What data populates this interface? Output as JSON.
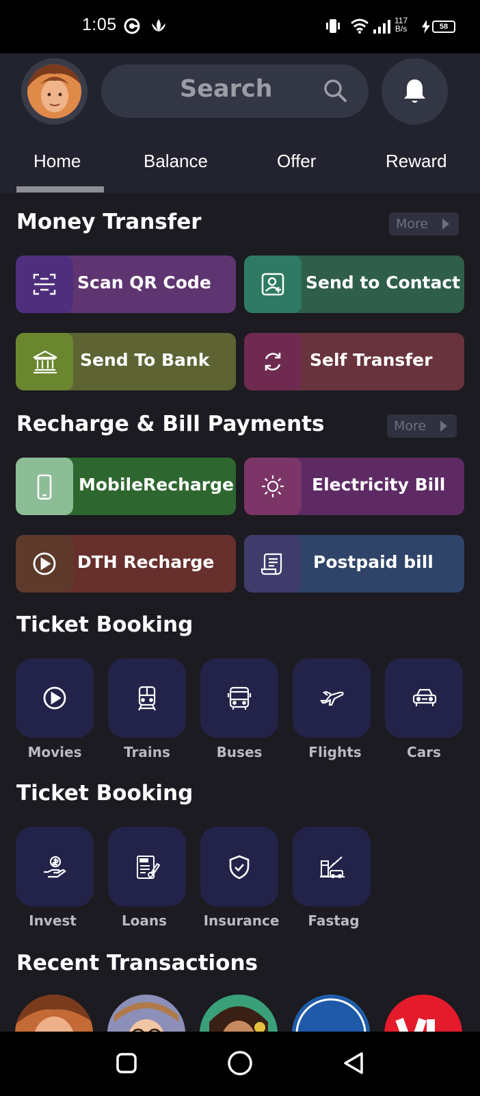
{
  "status_bar": {
    "time": "1:05",
    "net_speed_value": "117",
    "net_speed_unit": "B/s",
    "battery": "58"
  },
  "header": {
    "search_placeholder": "Search"
  },
  "tabs": [
    {
      "label": "Home",
      "active": true
    },
    {
      "label": "Balance",
      "active": false
    },
    {
      "label": "Offer",
      "active": false
    },
    {
      "label": "Reward",
      "active": false
    }
  ],
  "money_transfer": {
    "title": "Money Transfer",
    "more_label": "More",
    "items": [
      {
        "label": "Scan QR Code",
        "icon": "qr-scan-icon",
        "color": "#5f3571",
        "icon_bg": "#4e2f7d"
      },
      {
        "label": "Send to Contact",
        "icon": "contact-icon",
        "color": "#2f5e4b",
        "icon_bg": "#2e7a63"
      },
      {
        "label": "Send To Bank",
        "icon": "bank-icon",
        "color": "#5e6334",
        "icon_bg": "#6a862e"
      },
      {
        "label": "Self Transfer",
        "icon": "refresh-icon",
        "color": "#68333c",
        "icon_bg": "#6f2a50"
      }
    ]
  },
  "recharge": {
    "title": "Recharge & Bill Payments",
    "more_label": "More",
    "items": [
      {
        "label": "MobileRecharge",
        "icon": "mobile-icon",
        "color": "#2e662f",
        "icon_bg": "#8dbd97"
      },
      {
        "label": "Electricity Bill",
        "icon": "sun-icon",
        "color": "#5d2a64",
        "icon_bg": "#7b3566"
      },
      {
        "label": "DTH Recharge",
        "icon": "play-circle-icon",
        "color": "#67302d",
        "icon_bg": "#5d3a2c"
      },
      {
        "label": "Postpaid bill",
        "icon": "receipt-icon",
        "color": "#2f4468",
        "icon_bg": "#3f3c6c"
      }
    ]
  },
  "ticket_booking": {
    "title": "Ticket Booking",
    "items": [
      {
        "label": "Movies",
        "icon": "play-circle-icon"
      },
      {
        "label": "Trains",
        "icon": "train-icon"
      },
      {
        "label": "Buses",
        "icon": "bus-icon"
      },
      {
        "label": "Flights",
        "icon": "plane-icon"
      },
      {
        "label": "Cars",
        "icon": "car-icon"
      }
    ]
  },
  "finance": {
    "title": "Ticket Booking",
    "items": [
      {
        "label": "Invest",
        "icon": "invest-icon"
      },
      {
        "label": "Loans",
        "icon": "loan-icon"
      },
      {
        "label": "Insurance",
        "icon": "shield-check-icon"
      },
      {
        "label": "Fastag",
        "icon": "toll-icon"
      }
    ]
  },
  "recent": {
    "title": "Recent Transactions"
  },
  "colors": {
    "background": "#1b1b21",
    "header": "#22232e",
    "tile": "#23234a"
  }
}
